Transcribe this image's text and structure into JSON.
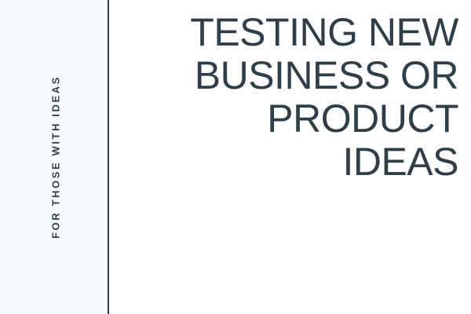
{
  "sidebar": {
    "tagline": "FOR THOSE WITH IDEAS"
  },
  "main": {
    "title_lines": [
      "TESTING NEW",
      "BUSINESS OR",
      "PRODUCT",
      "IDEAS"
    ]
  },
  "colors": {
    "text": "#2f3f4a",
    "sidebar_bg": "#f6fafd",
    "page_bg": "#ffffff"
  }
}
